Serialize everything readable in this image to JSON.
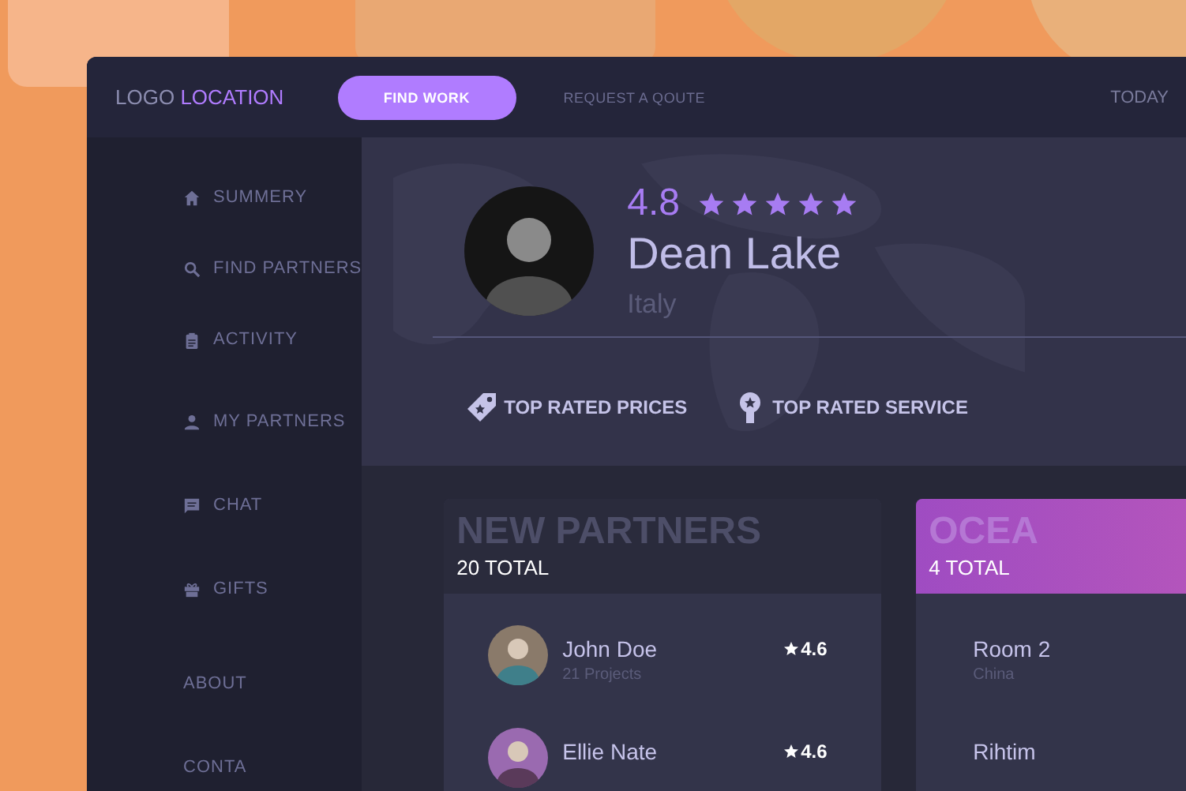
{
  "topbar": {
    "logo": "LOGO",
    "logo_accent": "LOCATION",
    "tabs": [
      {
        "label": "FIND WORK",
        "selected": true
      },
      {
        "label": "REQUEST A QOUTE",
        "selected": false
      }
    ],
    "date": "TODAY"
  },
  "sidebar": {
    "items": [
      {
        "label": "SUMMERY"
      },
      {
        "label": "FIND PARTNERS"
      },
      {
        "label": "ACTIVITY"
      },
      {
        "label": "MY PARTNERS"
      },
      {
        "label": "CHAT"
      },
      {
        "label": "GIFTS"
      }
    ],
    "links": [
      "ABOUT",
      "CONTA"
    ]
  },
  "profile": {
    "rating": "4.8",
    "stars": 5,
    "name": "Dean Lake",
    "country": "Italy",
    "badges": [
      "TOP RATED PRICES",
      "TOP RATED SERVICE"
    ]
  },
  "cards": [
    {
      "kind": "plain",
      "title": "NEW PARTNERS",
      "total": "20 TOTAL",
      "rows": [
        {
          "name": "John Doe",
          "sub": "21 Projects",
          "rating": "4.6"
        },
        {
          "name": "Ellie Nate",
          "rating": "4.6"
        }
      ]
    },
    {
      "kind": "highlight",
      "title": "OCEA",
      "total": "4 TOTAL",
      "rows": [
        {
          "name": "Room 2",
          "sub": "China"
        },
        {
          "name": "Rihtim"
        }
      ]
    }
  ]
}
